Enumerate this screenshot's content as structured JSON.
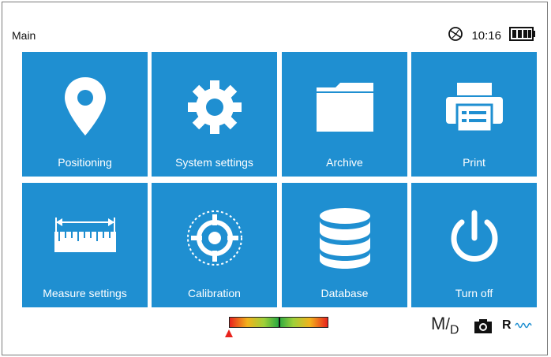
{
  "header": {
    "title": "Main",
    "time": "10:16"
  },
  "tiles": [
    {
      "label": "Positioning",
      "icon": "location-pin-icon"
    },
    {
      "label": "System settings",
      "icon": "gear-icon"
    },
    {
      "label": "Archive",
      "icon": "folder-icon"
    },
    {
      "label": "Print",
      "icon": "printer-icon"
    },
    {
      "label": "Measure settings",
      "icon": "ruler-icon"
    },
    {
      "label": "Calibration",
      "icon": "target-icon"
    },
    {
      "label": "Database",
      "icon": "database-icon"
    },
    {
      "label": "Turn off",
      "icon": "power-icon"
    }
  ],
  "footer": {
    "mode_m": "M",
    "mode_d": "D",
    "range_label": "R"
  },
  "colors": {
    "tile": "#1f8fd1",
    "background": "#ffffff"
  }
}
